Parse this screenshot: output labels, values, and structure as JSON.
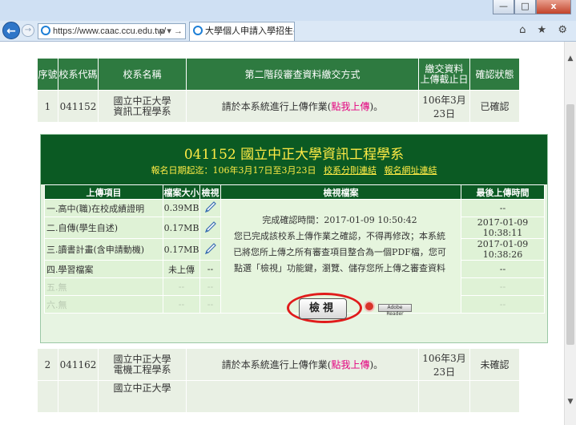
{
  "browser": {
    "address": "https://www.caac.ccu.edu.tw/",
    "address_controls": "ρ ▾ →",
    "tab_title": "大學個人申請入學招生-第...",
    "tab_close": "×",
    "tool_icons": "⌂ ★ ⚙",
    "window_min": "—",
    "window_max": "□",
    "window_close": "x"
  },
  "list": {
    "headers": [
      "序號",
      "校系代碼",
      "校系名稱",
      "第二階段審查資料繳交方式",
      "繳交資料\n上傳截止日",
      "確認狀態"
    ],
    "rows": [
      {
        "no": "1",
        "code": "041152",
        "name": "國立中正大學\n資訊工程學系",
        "method_prefix": "請於本系統進行上傳作業(",
        "method_link": "點我上傳",
        "method_suffix": ")。",
        "deadline": "106年3月23日",
        "status": "已確認"
      },
      {
        "no": "2",
        "code": "041162",
        "name": "國立中正大學\n電機工程學系",
        "method_prefix": "請於本系統進行上傳作業(",
        "method_link": "點我上傳",
        "method_suffix": ")。",
        "deadline": "106年3月23日",
        "status": "未確認"
      }
    ],
    "partial_row_name": "國立中正大學"
  },
  "panel": {
    "title": "041152 國立中正大學資訊工程學系",
    "dates": "報名日期起迄：106年3月17日至3月23日",
    "link_site": "校系分則連結",
    "link_form": "報名網址連結",
    "headers": [
      "上傳項目",
      "檔案大小",
      "檢視",
      "檢視檔案",
      "最後上傳時間"
    ],
    "items": [
      {
        "name": "一.高中(職)在校成績證明",
        "size": "0.39MB",
        "has_view": true,
        "time": "--"
      },
      {
        "name": "二.自傳(學生自述)",
        "size": "0.17MB",
        "has_view": true,
        "time": "2017-01-09 10:38:11"
      },
      {
        "name": "三.讀書計畫(含申請動機)",
        "size": "0.17MB",
        "has_view": true,
        "time": "2017-01-09 10:38:26"
      },
      {
        "name": "四.學習檔案",
        "size": "未上傳",
        "view": "--",
        "time": "--"
      },
      {
        "name": "五.無",
        "size": "--",
        "view": "--",
        "time": "--"
      },
      {
        "name": "六.無",
        "size": "--",
        "view": "--",
        "time": "--"
      }
    ],
    "confirm_time": "完成確認時間：2017-01-09 10:50:42",
    "message_line1": "您已完成該校系上傳作業之確認，不得再修改；本系統",
    "message_line2": "已將您所上傳之所有審查項目整合為一個PDF檔，您可",
    "message_line3": "點選「檢視」功能鍵，瀏覽、儲存您所上傳之審查資料",
    "view_button": "檢視",
    "reader_badge": "Adobe Reader"
  }
}
